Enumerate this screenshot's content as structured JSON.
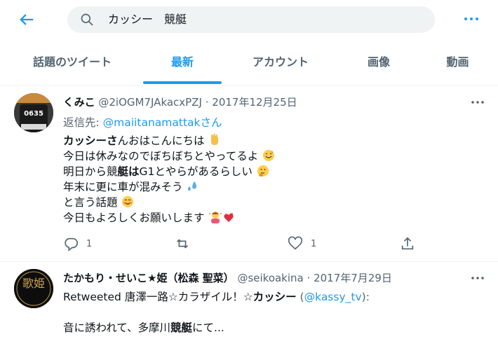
{
  "search": {
    "query": "カッシー　競艇"
  },
  "tabs": [
    {
      "label": "話題のツイート"
    },
    {
      "label": "最新"
    },
    {
      "label": "アカウント"
    },
    {
      "label": "画像"
    },
    {
      "label": "動画"
    }
  ],
  "tweet1": {
    "avatar_text": "0635",
    "name": "くみこ",
    "handle": "@2iOGM7JAkacxPZJ",
    "sep": "·",
    "date": "2017年12月25日",
    "reply_prefix": "返信先: ",
    "reply_handle": "@maiitanamattak",
    "reply_suffix": "さん",
    "lines": [
      {
        "a": "カッシー",
        "b": "さ",
        "c": "んおはこんにちは"
      },
      {
        "text": "今日は休みなのでぼちぼちとやってるよ"
      },
      {
        "a": "明日から競",
        "b": "艇は",
        "c": "G1とやらがあるらしい"
      },
      {
        "text": "年末に更に車が混みそう"
      },
      {
        "text": "と言う話題"
      },
      {
        "text": "今日もよろしくお願いします"
      }
    ],
    "reply_count": "1",
    "like_count": "1"
  },
  "tweet2": {
    "avatar_text": "歌姫",
    "name": "たかもり・せいこ★姫（松森 聖菜）",
    "handle": "@seikoakina",
    "sep": "·",
    "date": "2017年7月29日",
    "rt_prefix": "Retweeted 唐澤一路☆カラザイル！☆",
    "rt_bold": "カッシー",
    "rt_open": " (",
    "rt_handle": "@kassy_tv",
    "rt_close": "):",
    "text_a": "音に誘われて、多摩川",
    "text_b": "競艇",
    "text_c": "にて..."
  },
  "colors": {
    "accent": "#1d9bf0",
    "muted": "#536471",
    "text": "#0f1419"
  }
}
